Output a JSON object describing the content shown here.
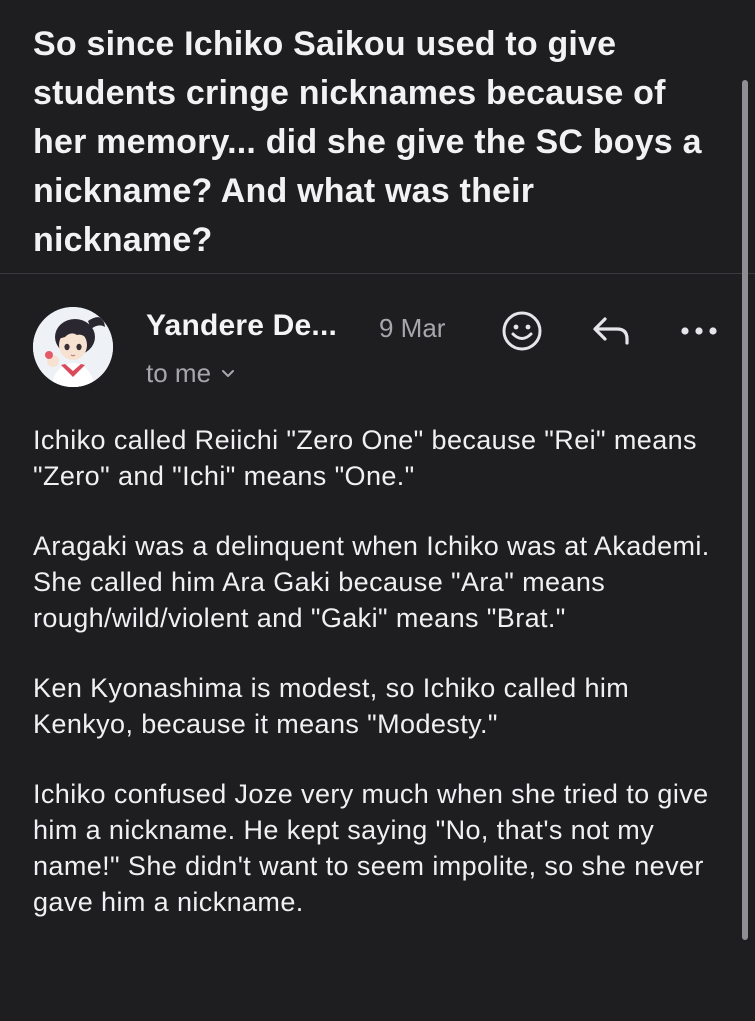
{
  "email": {
    "subject": "So since Ichiko Saikou used to give students cringe nicknames because of her memory... did she give the SC boys a nickname? And what was their nickname?",
    "sender": "Yandere De...",
    "date": "9 Mar",
    "recipient": "to me",
    "paragraphs": [
      "Ichiko called Reiichi \"Zero One\" because \"Rei\" means \"Zero\" and \"Ichi\" means \"One.\"",
      "Aragaki was a delinquent when Ichiko was at Akademi. She called him Ara Gaki because \"Ara\" means rough/wild/violent and \"Gaki\" means \"Brat.\"",
      "Ken Kyonashima is modest, so Ichiko called him Kenkyo, because it means \"Modesty.\"",
      "Ichiko confused Joze very much when she tried to give him a nickname. He kept saying \"No, that's not my name!\" She didn't want to seem impolite, so she never gave him a nickname."
    ]
  },
  "icons": {
    "avatar": "anime-avatar",
    "emoji": "smiley-face-icon",
    "reply": "reply-arrow-icon",
    "more": "more-dots-icon",
    "recipient_toggle": "chevron-down-icon"
  },
  "colors": {
    "background": "#1e1e21",
    "text_primary": "#f2f2f4",
    "text_secondary": "#a6a6ac",
    "divider": "#3a3a3e"
  }
}
